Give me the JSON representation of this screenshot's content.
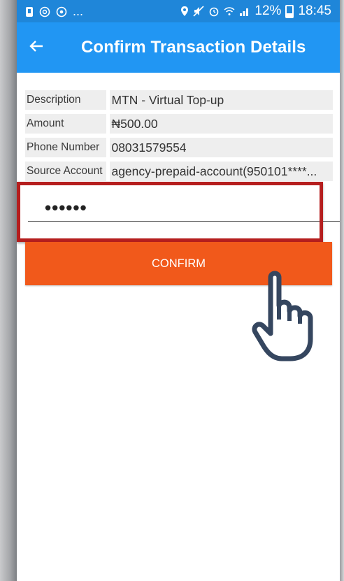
{
  "statusbar": {
    "left_icons": [
      "notification-icon",
      "whatsapp-icon",
      "at-icon"
    ],
    "left_more": "...",
    "right_icons": [
      "location-icon",
      "mute-icon",
      "alarm-icon",
      "wifi-icon",
      "signal-icon"
    ],
    "battery_percent": "12%",
    "time": "18:45"
  },
  "appbar": {
    "title": "Confirm Transaction Details",
    "back_icon": "arrow-back-icon"
  },
  "details": [
    {
      "label": "Description",
      "value": "MTN - Virtual Top-up"
    },
    {
      "label": "Amount",
      "value": "₦500.00"
    },
    {
      "label": "Phone Number",
      "value": "08031579554"
    },
    {
      "label": "Source Account",
      "value": "agency-prepaid-account(950101****..."
    }
  ],
  "pin_field": {
    "masked_value": "••••••"
  },
  "confirm_button": {
    "label": "CONFIRM"
  },
  "colors": {
    "statusbar": "#1f86d9",
    "appbar": "#2196f3",
    "confirm_button": "#f1591b",
    "highlight_border": "#b51e1e"
  }
}
